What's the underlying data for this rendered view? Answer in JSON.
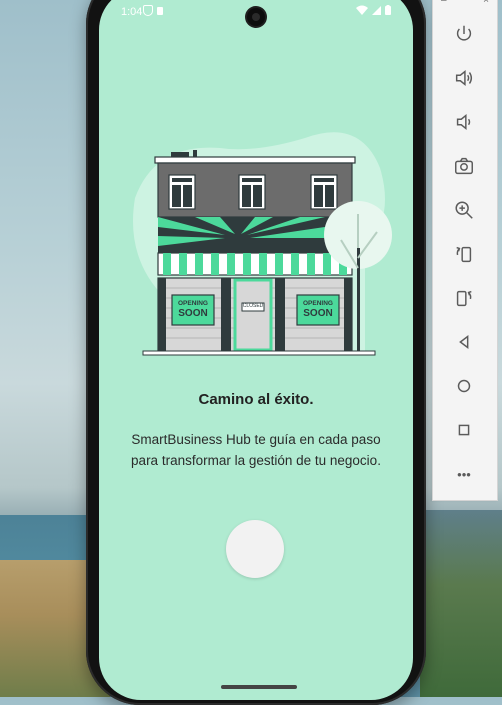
{
  "status_bar": {
    "time": "1:04"
  },
  "screen": {
    "illustration": {
      "sign_left_line1": "OPENING",
      "sign_left_line2": "SOON",
      "sign_right_line1": "OPENING",
      "sign_right_line2": "SOON",
      "door_sign": "CLOSED"
    },
    "title": "Camino al éxito.",
    "description": "SmartBusiness Hub te guía en cada paso para transformar la gestión de tu negocio."
  },
  "emulator_panel": {
    "tools": [
      {
        "icon": "power-icon"
      },
      {
        "icon": "volume-up-icon"
      },
      {
        "icon": "volume-down-icon"
      },
      {
        "icon": "camera-icon"
      },
      {
        "icon": "zoom-in-icon"
      },
      {
        "icon": "rotate-left-icon"
      },
      {
        "icon": "rotate-right-icon"
      },
      {
        "icon": "back-icon"
      },
      {
        "icon": "home-icon"
      },
      {
        "icon": "overview-icon"
      },
      {
        "icon": "more-icon"
      }
    ],
    "more_label": "•••"
  },
  "colors": {
    "screen_background": "#b0ebd1",
    "accent_green": "#4cd99b",
    "dark_building": "#2f3b3d"
  }
}
